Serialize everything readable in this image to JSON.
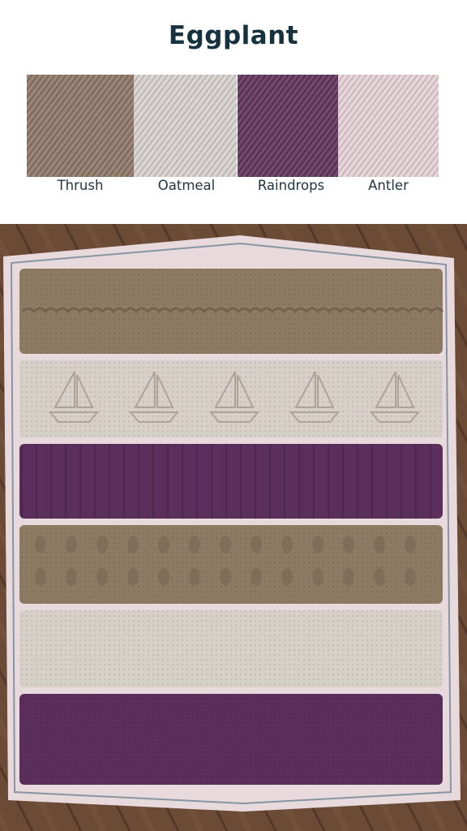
{
  "title": "Eggplant",
  "swatches": [
    {
      "label": "Thrush",
      "color": "#8b7668",
      "highlight": "#a08b7d",
      "shadow": "#6c5a4e",
      "icon": "yarn-swatch-icon"
    },
    {
      "label": "Oatmeal",
      "color": "#cfc9c6",
      "highlight": "#e0dbd8",
      "shadow": "#aaa39f",
      "icon": "yarn-swatch-icon"
    },
    {
      "label": "Raindrops",
      "color": "#5e3a5d",
      "highlight": "#7a4f77",
      "shadow": "#432742",
      "icon": "yarn-swatch-icon"
    },
    {
      "label": "Antler",
      "color": "#dac6cb",
      "highlight": "#ebdde0",
      "shadow": "#bba6ab",
      "icon": "yarn-swatch-icon"
    }
  ],
  "photo": {
    "subject": "crocheted-blanket",
    "colors": {
      "floor": "#6b4a36",
      "floor_dark": "#4a3124",
      "border": "#e8d9dc",
      "thrush": "#8e7b63",
      "oatmeal": "#d6d0c8",
      "raindrops": "#5b2f5c",
      "antler": "#e9d8db"
    }
  }
}
